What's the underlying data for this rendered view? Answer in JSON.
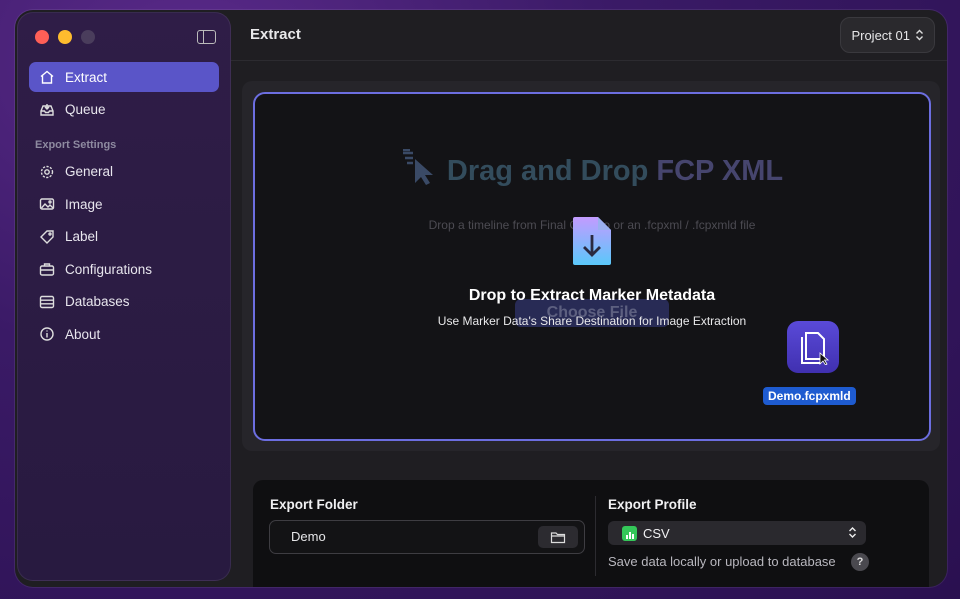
{
  "window": {
    "title": "Extract"
  },
  "sidebar": {
    "primary": [
      {
        "label": "Extract",
        "icon": "house-icon",
        "active": true
      },
      {
        "label": "Queue",
        "icon": "tray-icon"
      }
    ],
    "section_label": "Export Settings",
    "settings": [
      {
        "label": "General",
        "icon": "gear-icon"
      },
      {
        "label": "Image",
        "icon": "image-icon"
      },
      {
        "label": "Label",
        "icon": "tag-icon"
      },
      {
        "label": "Configurations",
        "icon": "briefcase-icon"
      },
      {
        "label": "Databases",
        "icon": "database-icon"
      },
      {
        "label": "About",
        "icon": "info-icon"
      }
    ]
  },
  "header": {
    "project": "Project 01"
  },
  "dropzone": {
    "title_part1": "Drag and Drop ",
    "title_part2": "FCP XML",
    "subtitle": "Drop a timeline from Final Cut Pro or an .fcpxml / .fcpxmld file",
    "choose_file": "Choose File",
    "overlay_title": "Drop to Extract Marker Metadata",
    "overlay_desc": "Use Marker Data's Share Destination for Image Extraction",
    "dragged_file": "Demo.fcpxmld"
  },
  "export": {
    "folder_title": "Export Folder",
    "folder_value": "Demo",
    "profile_title": "Export Profile",
    "profile_value": "CSV",
    "profile_hint": "Save data locally or upload to database",
    "help": "?"
  },
  "colors": {
    "accent": "#5a55c8",
    "drop_border": "#6c6ee0",
    "file_label": "#1e5bd0"
  }
}
